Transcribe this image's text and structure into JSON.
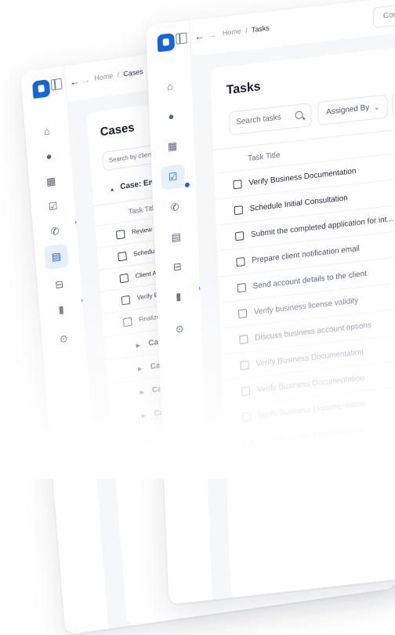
{
  "back_window": {
    "breadcrumb": {
      "home": "Home",
      "separator": "/",
      "current": "Cases"
    },
    "title": "Cases",
    "search": {
      "placeholder": "Search by client name"
    },
    "case_group": {
      "label": "Case: Enroll Client"
    },
    "column_header": "Task Title",
    "tasks": [
      {
        "title": "Review Initial Documents"
      },
      {
        "title": "Schedule Consultation"
      },
      {
        "title": "Client Approval"
      },
      {
        "title": "Verify Business Information"
      },
      {
        "title": "Finalize Enrollment"
      }
    ],
    "collapsed_groups": [
      {
        "label": "Case: Enroll"
      },
      {
        "label": "Case: Open"
      },
      {
        "label": "Case: Open"
      },
      {
        "label": "Case: Open"
      }
    ]
  },
  "front_window": {
    "breadcrumb": {
      "home": "Home",
      "separator": "/",
      "current": "Tasks"
    },
    "top_button": "Cont",
    "title": "Tasks",
    "search": {
      "placeholder": "Search tasks"
    },
    "filter": {
      "label": "Assigned By",
      "icon": "chevron-down-icon"
    },
    "column_header": "Task Title",
    "tasks": [
      {
        "title": "Verify Business Documentation"
      },
      {
        "title": "Schedule Initial Consultation"
      },
      {
        "title": "Submit the completed application for int..."
      },
      {
        "title": "Prepare client notification email"
      },
      {
        "title": "Send account details to the client"
      },
      {
        "title": "Verify business license validity"
      },
      {
        "title": "Discuss business account options"
      },
      {
        "title": "Verify Business Documentation"
      },
      {
        "title": "Verify Business Documentation"
      },
      {
        "title": "Verify Business Documentation"
      },
      {
        "title": "Verify Business Documentation"
      }
    ]
  },
  "colors": {
    "accent": "#1565d8",
    "notification_dot": "#1e63e0",
    "active_bg": "#e7efff"
  }
}
